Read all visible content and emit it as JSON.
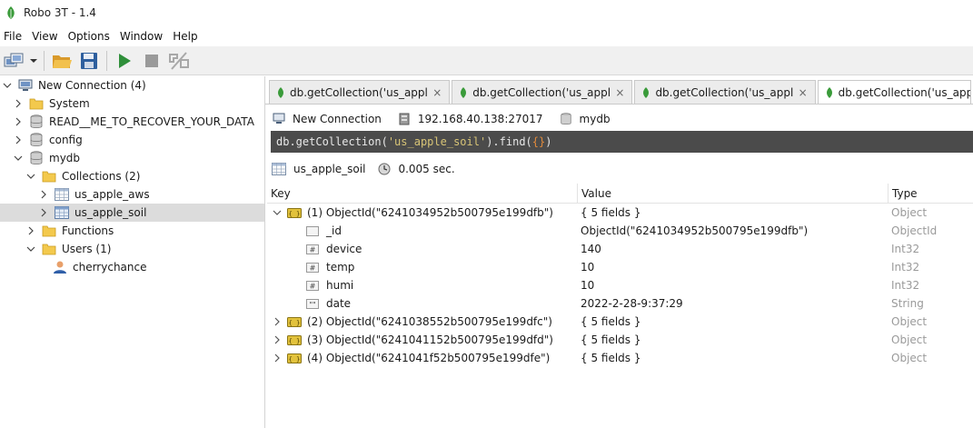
{
  "window": {
    "title": "Robo 3T - 1.4"
  },
  "menu": [
    "File",
    "View",
    "Options",
    "Window",
    "Help"
  ],
  "toolbar": {
    "icons": [
      "connect-icon",
      "open-icon",
      "save-icon",
      "execute-icon",
      "stop-icon",
      "format-icon"
    ]
  },
  "tree": {
    "connection": "New Connection (4)",
    "databases": [
      "System",
      "READ__ME_TO_RECOVER_YOUR_DATA",
      "config",
      "mydb"
    ],
    "collections_folder": "Collections (2)",
    "collections": [
      "us_apple_aws",
      "us_apple_soil"
    ],
    "functions": "Functions",
    "users": "Users (1)",
    "user": "cherrychance"
  },
  "tabs": [
    {
      "label": "db.getCollection('us_appl···",
      "close": "×"
    },
    {
      "label": "db.getCollection('us_appl···",
      "close": "×"
    },
    {
      "label": "db.getCollection('us_appl···",
      "close": "×"
    },
    {
      "label": "db.getCollection('us_apple"
    }
  ],
  "connection_info": {
    "name": "New Connection",
    "host": "192.168.40.138:27017",
    "db": "mydb"
  },
  "query": {
    "prefix": "db.getCollection(",
    "collection": "'us_apple_soil'",
    "middle": ").find(",
    "braces": "{}",
    "suffix": ")"
  },
  "result_info": {
    "collection": "us_apple_soil",
    "time": "0.005 sec."
  },
  "grid": {
    "headers": {
      "key": "Key",
      "value": "Value",
      "type": "Type"
    },
    "rows": [
      {
        "key": "(1) ObjectId(\"6241034952b500795e199dfb\")",
        "value": "{ 5 fields }",
        "type": "Object"
      },
      {
        "key": "_id",
        "value": "ObjectId(\"6241034952b500795e199dfb\")",
        "type": "ObjectId"
      },
      {
        "key": "device",
        "value": "140",
        "type": "Int32"
      },
      {
        "key": "temp",
        "value": "10",
        "type": "Int32"
      },
      {
        "key": "humi",
        "value": "10",
        "type": "Int32"
      },
      {
        "key": "date",
        "value": "2022-2-28-9:37:29",
        "type": "String"
      },
      {
        "key": "(2) ObjectId(\"6241038552b500795e199dfc\")",
        "value": "{ 5 fields }",
        "type": "Object"
      },
      {
        "key": "(3) ObjectId(\"6241041152b500795e199dfd\")",
        "value": "{ 5 fields }",
        "type": "Object"
      },
      {
        "key": "(4) ObjectId(\"6241041f52b500795e199dfe\")",
        "value": "{ 5 fields }",
        "type": "Object"
      }
    ]
  },
  "colors": {
    "leaf_green": "#3a9b3a",
    "query_bg": "#4b4b4b",
    "selected_row": "#dcdcdc",
    "folder": "#f3c94d"
  }
}
